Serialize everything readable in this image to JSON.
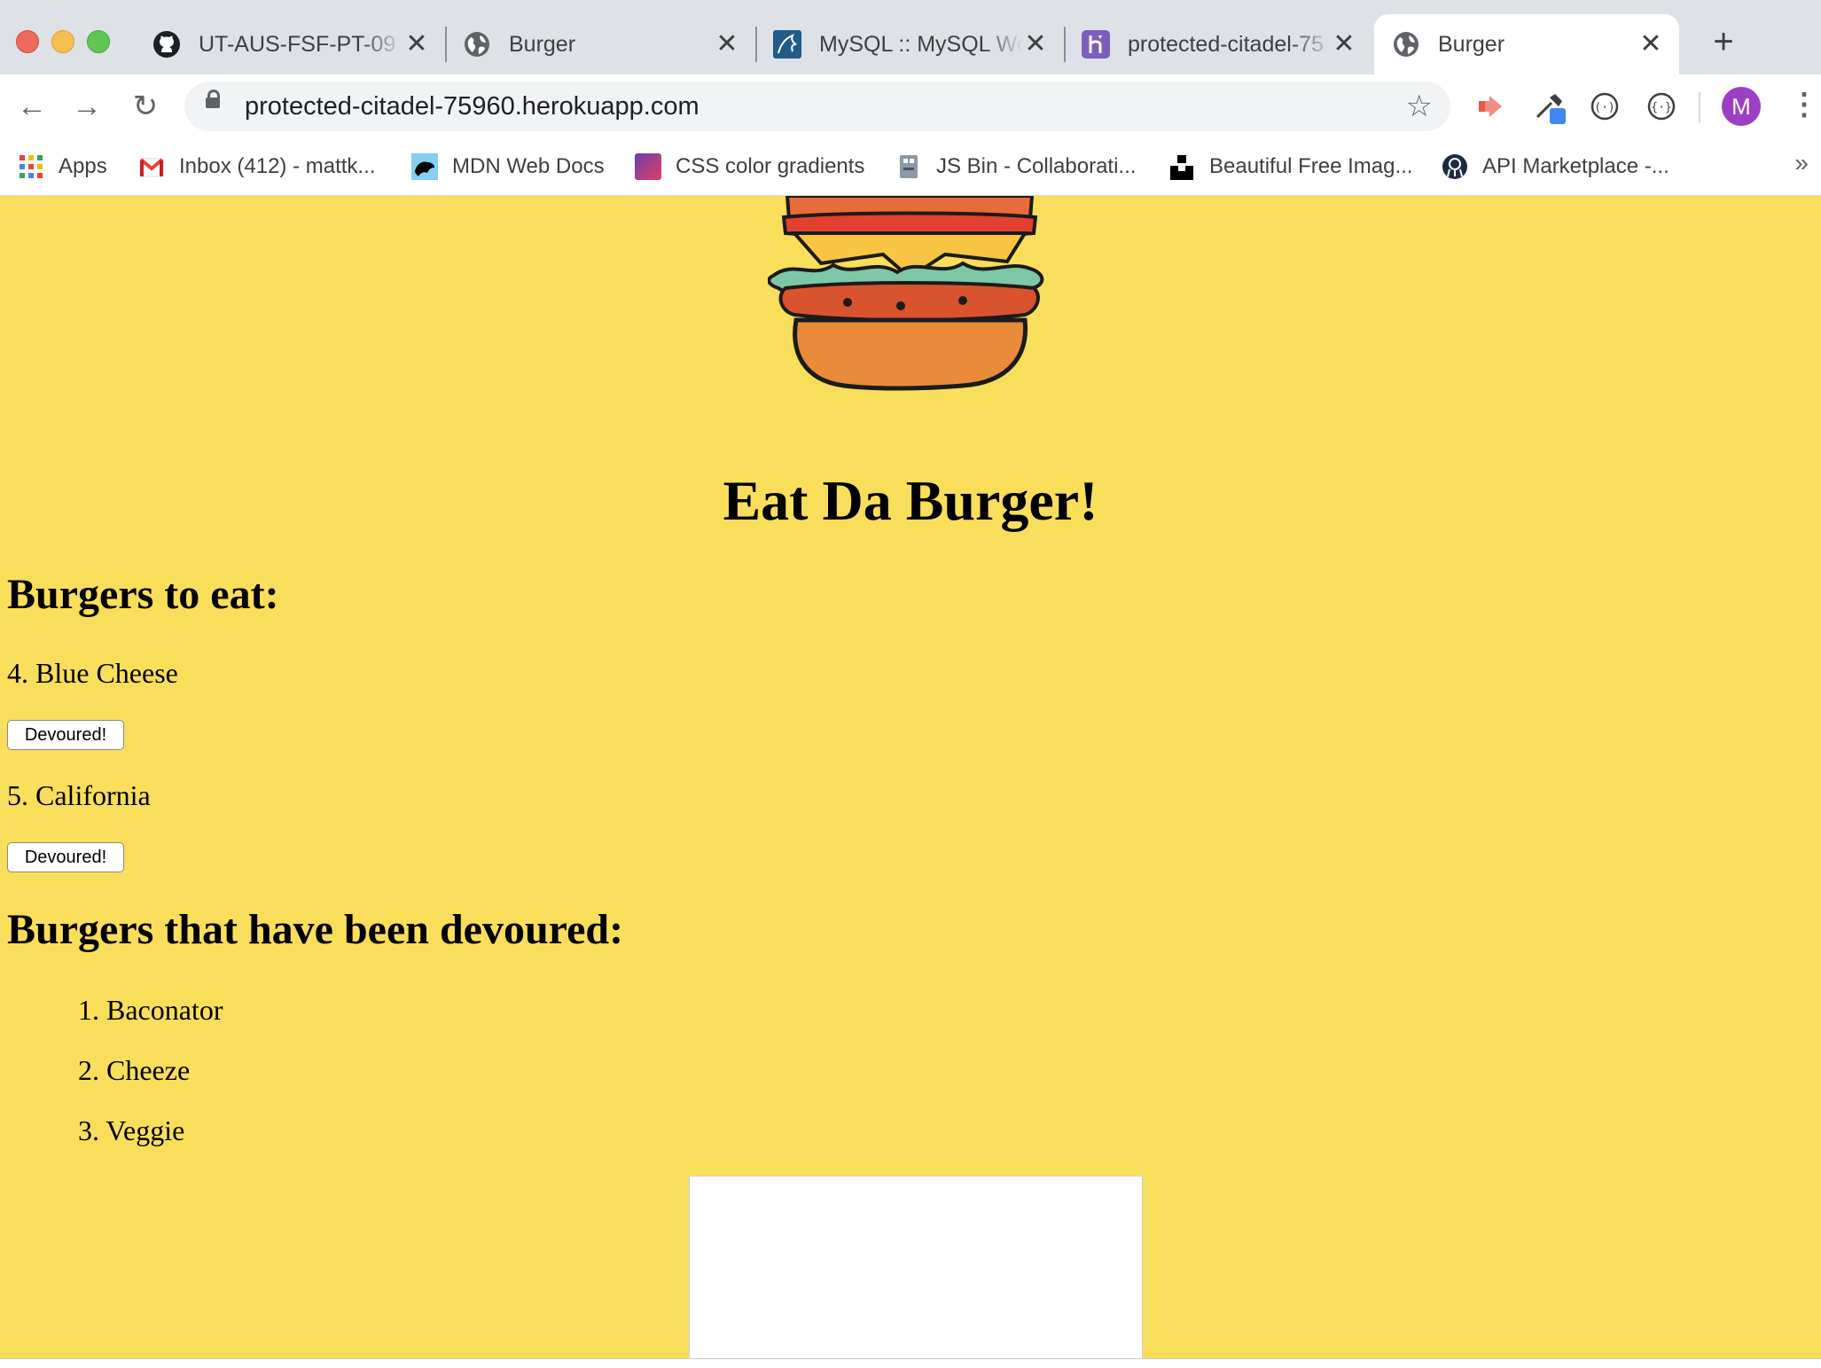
{
  "browser": {
    "tabs": [
      {
        "title": "UT-AUS-FSF-PT-09",
        "icon": "github-icon",
        "active": false
      },
      {
        "title": "Burger",
        "icon": "globe-icon",
        "active": false
      },
      {
        "title": "MySQL :: MySQL Wo",
        "icon": "mysql-icon",
        "active": false
      },
      {
        "title": "protected-citadel-75",
        "icon": "heroku-icon",
        "active": false
      },
      {
        "title": "Burger",
        "icon": "globe-icon",
        "active": true
      }
    ],
    "new_tab_symbol": "+",
    "close_symbol": "✕",
    "url": "protected-citadel-75960.herokuapp.com",
    "avatar_initial": "M",
    "bookmarks": [
      {
        "label": "Apps",
        "icon": "apps-grid-icon"
      },
      {
        "label": "Inbox (412) - mattk...",
        "icon": "gmail-icon"
      },
      {
        "label": "MDN Web Docs",
        "icon": "mdn-icon"
      },
      {
        "label": "CSS color gradients",
        "icon": "gradient-icon"
      },
      {
        "label": "JS Bin - Collaborati...",
        "icon": "jsbin-icon"
      },
      {
        "label": "Beautiful Free Imag...",
        "icon": "unsplash-icon"
      },
      {
        "label": "API Marketplace -...",
        "icon": "rapidapi-icon"
      }
    ],
    "bookmarks_more": "»"
  },
  "page": {
    "heading": "Eat Da Burger!",
    "to_eat_heading": "Burgers to eat:",
    "to_eat": [
      {
        "text": "4. Blue Cheese",
        "button": "Devoured!"
      },
      {
        "text": "5. California",
        "button": "Devoured!"
      }
    ],
    "devoured_heading": "Burgers that have been devoured:",
    "devoured": [
      "1. Baconator",
      "2. Cheeze",
      "3. Veggie"
    ]
  },
  "colors": {
    "page_background": "#f9de5b",
    "tab_strip": "#dee1e6",
    "avatar": "#9c3fc4"
  }
}
